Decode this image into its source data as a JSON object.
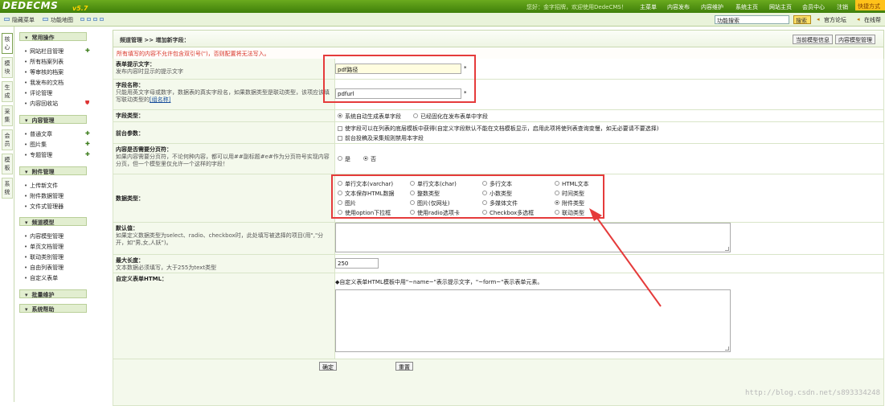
{
  "topbar": {
    "logo": "DEDECMS",
    "version": "v5.7",
    "welcome": "您好：金字招牌，欢迎使用DedeCMS！",
    "nav": [
      "主菜单",
      "内容发布",
      "内容维护",
      "系统主页",
      "网站主页",
      "会员中心",
      "注销"
    ],
    "quick": "快捷方式"
  },
  "toolbar": {
    "hide_menu": "隐藏菜单",
    "function_map": "功能地图",
    "search_value": "功能搜索",
    "search_button": "搜索",
    "forum": "官方论坛",
    "online_help": "在线帮"
  },
  "vtabs": [
    "核心",
    "模块",
    "生成",
    "采集",
    "会员",
    "模板",
    "系统"
  ],
  "sidebar": {
    "groups": [
      {
        "title": "常用操作",
        "items": [
          "网站栏目管理",
          "所有档案列表",
          "等审核的档案",
          "我发布的文档",
          "评论管理",
          "内容回收站"
        ]
      },
      {
        "title": "内容管理",
        "items": [
          "普通文章",
          "图片集",
          "专题管理"
        ]
      },
      {
        "title": "附件管理",
        "items": [
          "上传新文件",
          "附件数据管理",
          "文件式管理器"
        ]
      },
      {
        "title": "频道模型",
        "items": [
          "内容模型管理",
          "单页文档管理",
          "联动类别管理",
          "自由列表管理",
          "自定义表单"
        ]
      },
      {
        "title": "批量维护",
        "items": []
      },
      {
        "title": "系统帮助",
        "items": []
      }
    ]
  },
  "breadcrumb": "频道管理 >> 增加新字段：",
  "header_buttons": [
    "当前模型信息",
    "内容模型管理"
  ],
  "warning": "所有填写的内容不允许包含双引号(\")，否则配置将无法写入。",
  "form": {
    "label_text": {
      "title": "表单提示文字：",
      "help": "发布内容时显示的提示文字",
      "value": "pdf路径"
    },
    "field_name": {
      "title": "字段名称：",
      "help": "只能用英文字母或数字，数据表的真实字段名，如果数据类型是联动类型，该项应该填写联动类型的",
      "link": "[组名称]",
      "value": "pdfurl"
    },
    "field_type": {
      "title": "字段类型：",
      "options": [
        "系统自动生成表单字段",
        "已经固化在发布表单中字段"
      ],
      "selected": 0
    },
    "frontend": {
      "title": "前台参数：",
      "options": [
        "使字段可以在列表的底层模板中获得(自定义字段默认不能在文档模板显示，启用此项将使列表查询变慢，如无必要请不要选择)",
        "前台投稿及采集规则禁用本字段"
      ]
    },
    "paging": {
      "title": "内容是否需要分页符：",
      "help": "如果内容需要分页符，不论何种内容，都可以用##副标题#e#作为分页符号实现内容分页，但一个模型里仅允许一个这样的字段！",
      "options": [
        "是",
        "否"
      ],
      "selected": 1
    },
    "data_type": {
      "title": "数据类型：",
      "options": [
        "单行文本(varchar)",
        "单行文本(char)",
        "多行文本",
        "HTML文本",
        "文本保存HTML数据",
        "整数类型",
        "小数类型",
        "时间类型",
        "图片",
        "图片(仅网址)",
        "多媒体文件",
        "附件类型",
        "使用option下拉框",
        "使用radio选项卡",
        "Checkbox多选框",
        "联动类型"
      ],
      "selected": 11
    },
    "default_value": {
      "title": "默认值：",
      "help": "如果定义数据类型为select、radio、checkbox时，此处填写被选择的项目(用\",\"分开，如\"男,女,人妖\")。"
    },
    "max_length": {
      "title": "最大长度：",
      "help": "文本数据必须填写，大于255为text类型",
      "value": "250"
    },
    "custom_html": {
      "title": "自定义表单HTML：",
      "hint": "◆自定义表单HTML模板中用\"~name~\"表示提示文字，\"~form~\"表示表单元素。"
    }
  },
  "footer": {
    "confirm": "确定",
    "reset": "重置"
  },
  "watermark": "http://blog.csdn.net/s893334248"
}
